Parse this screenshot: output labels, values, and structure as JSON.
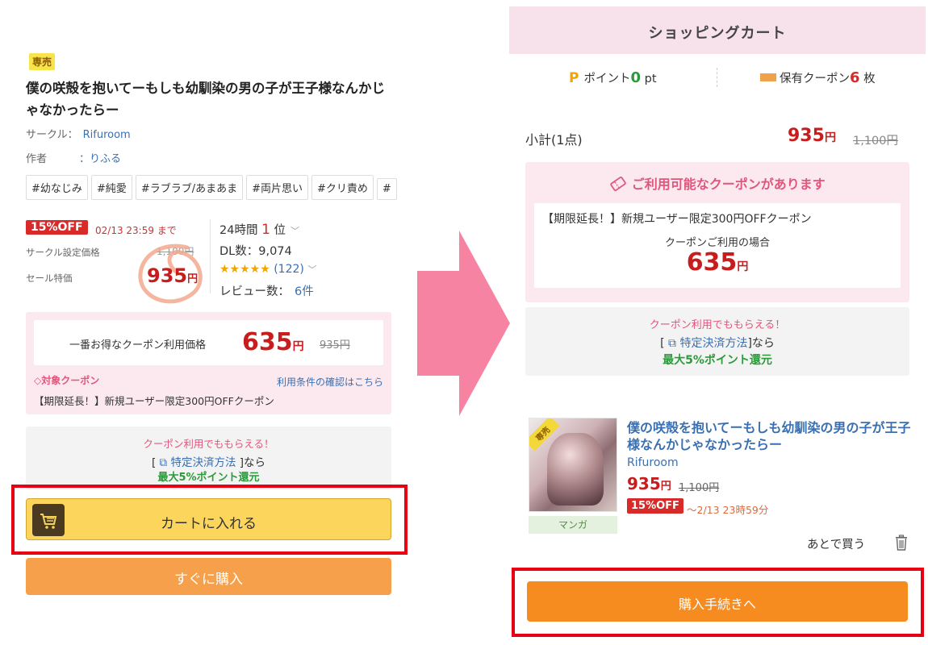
{
  "product": {
    "exclusive_badge": "専売",
    "title": "僕の咲殻を抱いてーもしも幼馴染の男の子が王子様なんかじゃなかったらー",
    "circle_label": "サークル：",
    "circle_value": "Rifuroom",
    "author_label": "作者",
    "author_value": "：りふる",
    "tags": [
      "#幼なじみ",
      "#純愛",
      "#ラブラブ/あまあま",
      "#両片思い",
      "#クリ責め",
      "#"
    ],
    "discount_badge": "15%OFF",
    "discount_until": "02/13 23:59 まで",
    "circle_price_label": "サークル設定価格",
    "circle_price": "1,100円",
    "sale_price_label": "セール特価",
    "sale_price": "935",
    "yen": "円",
    "ranking_prefix": "24時間",
    "ranking_num": "1",
    "ranking_suffix": "位",
    "chevron": "﹀",
    "downloads": "DL数：9,074",
    "stars": "★★★★★",
    "rating_count": "(122)",
    "reviews_label": "レビュー数：",
    "reviews_value": "6件",
    "rating": 5
  },
  "coupon_offer": {
    "label": "一番お得なクーポン利用価格",
    "price": "635",
    "yen": "円",
    "strike": "935円",
    "target_label": "◇対象クーポン",
    "terms_link": "利用条件の確認はこちら",
    "coupon_name": "【期限延長！】新規ユーザー限定300円OFFクーポン"
  },
  "points_promo": {
    "line1": "クーポン利用でももらえる！",
    "bracket_open": "[",
    "link_icon": "⧉",
    "link": "特定決済方法",
    "line2_suffix": "]なら",
    "line3": "最大5%ポイント還元"
  },
  "buttons": {
    "add_to_cart": "カートに入れる",
    "buy_now": "すぐに購入",
    "checkout": "購入手続きへ"
  },
  "cart": {
    "header_title": "ショッピングカート",
    "points_icon": "P",
    "points_label": "ポイント",
    "points_value": "0",
    "points_unit": "pt",
    "coupons_label": "保有クーポン",
    "coupons_value": "6",
    "coupons_unit": "枚",
    "subtotal_label": "小計(1点)",
    "subtotal_price": "935",
    "yen": "円",
    "subtotal_strike": "1,100円",
    "available_title": "ご利用可能なクーポンがあります",
    "available_coupon_name": "【期限延長！】新規ユーザー限定300円OFFクーポン",
    "coupon_use_label": "クーポンご利用の場合",
    "coupon_price": "635",
    "item": {
      "exclusive_badge": "専売",
      "title": "僕の咲殻を抱いてーもしも幼馴染の男の子が王子様なんかじゃなかったらー",
      "circle": "Rifuroom",
      "price": "935",
      "yen": "円",
      "strike": "1,100円",
      "discount_badge": "15%OFF",
      "until": "～2/13 23時59分",
      "category": "マンガ",
      "buy_later": "あとで買う"
    }
  },
  "colors": {
    "price_red": "#c81d1d",
    "accent_pink": "#e0567c",
    "cart_button": "#fcd55d",
    "checkout_button": "#f68b1f",
    "highlight_frame": "#e60012",
    "arrow": "#f783a3"
  },
  "icons": [
    "cart-icon",
    "trash-icon",
    "coupon-tag-icon",
    "external-link-icon",
    "arrow-right-icon",
    "ticket-icon"
  ]
}
